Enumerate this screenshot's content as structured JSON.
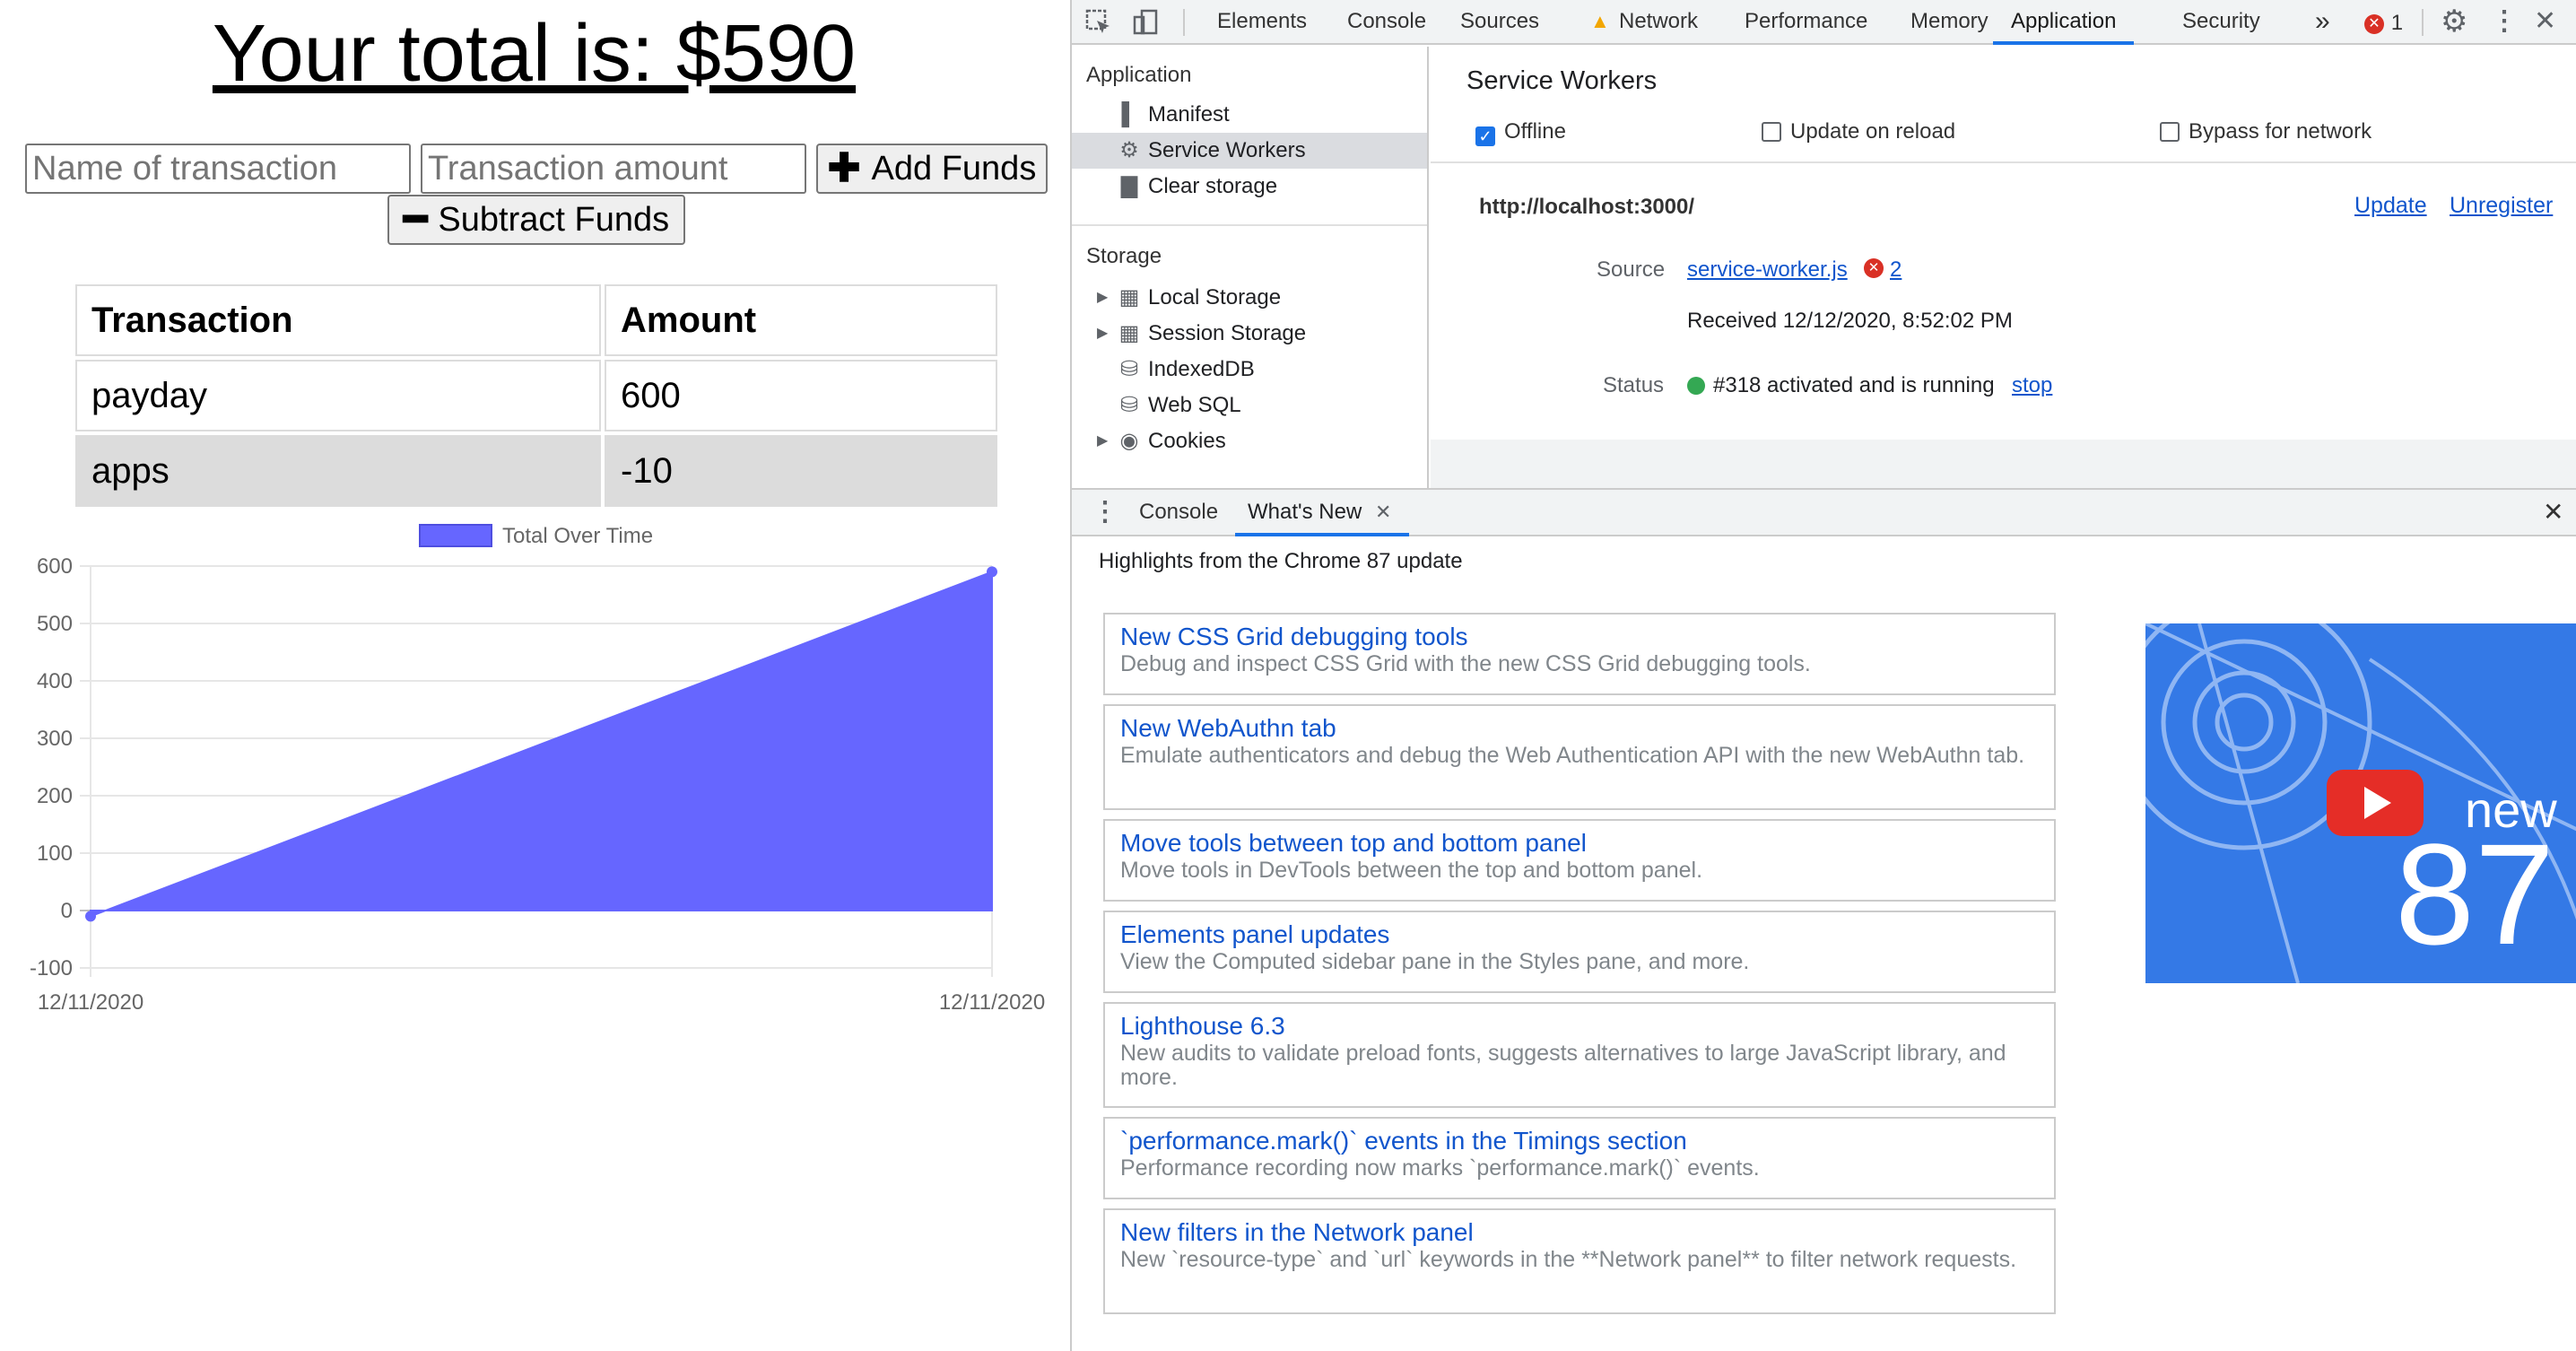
{
  "app": {
    "title": "Your total is: $590",
    "name_placeholder": "Name of transaction",
    "amount_placeholder": "Transaction amount",
    "add_label": "Add Funds",
    "subtract_label": "Subtract Funds",
    "table": {
      "headers": [
        "Transaction",
        "Amount"
      ],
      "rows": [
        {
          "name": "payday",
          "amount": "600"
        },
        {
          "name": "apps",
          "amount": "-10"
        }
      ]
    }
  },
  "chart_data": {
    "type": "area",
    "title": "",
    "x": [
      "12/11/2020",
      "12/11/2020"
    ],
    "series": [
      {
        "name": "Total Over Time",
        "values": [
          -10,
          590
        ],
        "color": "#6666ff"
      }
    ],
    "yticks": [
      600,
      500,
      400,
      300,
      200,
      100,
      0,
      -100
    ],
    "xticks": [
      "12/11/2020",
      "12/11/2020"
    ],
    "ylim": [
      -100,
      600
    ],
    "legend": "top-center",
    "grid": true
  },
  "devtools": {
    "tabs": [
      "Elements",
      "Console",
      "Sources",
      "Network",
      "Performance",
      "Memory",
      "Application",
      "Security"
    ],
    "active_tab": "Application",
    "more_tabs": "»",
    "error_count": "1",
    "sidebar": {
      "application_header": "Application",
      "application_items": [
        "Manifest",
        "Service Workers",
        "Clear storage"
      ],
      "storage_header": "Storage",
      "storage_items": [
        "Local Storage",
        "Session Storage",
        "IndexedDB",
        "Web SQL",
        "Cookies"
      ]
    },
    "service_workers": {
      "title": "Service Workers",
      "options": [
        "Offline",
        "Update on reload",
        "Bypass for network"
      ],
      "origin": "http://localhost:3000/",
      "update": "Update",
      "unregister": "Unregister",
      "source_label": "Source",
      "source_file": "service-worker.js",
      "source_errors": "2",
      "received": "Received 12/12/2020, 8:52:02 PM",
      "status_label": "Status",
      "status_text": "#318 activated and is running",
      "stop": "stop"
    },
    "drawer": {
      "tabs": [
        "Console",
        "What's New"
      ],
      "highlights": "Highlights from the Chrome 87 update",
      "items": [
        {
          "title": "New CSS Grid debugging tools",
          "desc": "Debug and inspect CSS Grid with the new CSS Grid debugging tools."
        },
        {
          "title": "New WebAuthn tab",
          "desc": "Emulate authenticators and debug the Web Authentication API with the new WebAuthn tab."
        },
        {
          "title": "Move tools between top and bottom panel",
          "desc": "Move tools in DevTools between the top and bottom panel."
        },
        {
          "title": "Elements panel updates",
          "desc": "View the Computed sidebar pane in the Styles pane, and more."
        },
        {
          "title": "Lighthouse 6.3",
          "desc": "New audits to validate preload fonts, suggests alternatives to large JavaScript library, and more."
        },
        {
          "title": "`performance.mark()` events in the Timings section",
          "desc": "Performance recording now marks `performance.mark()` events."
        },
        {
          "title": "New filters in the Network panel",
          "desc": "New `resource-type` and `url` keywords in the **Network panel** to filter network requests."
        }
      ],
      "video_word": "new",
      "video_number": "87"
    }
  }
}
